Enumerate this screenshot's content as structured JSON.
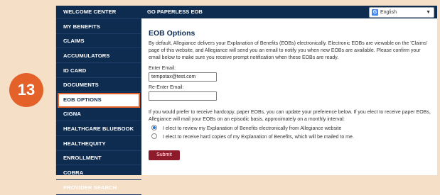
{
  "step_badge": "13",
  "sidebar": {
    "items": [
      {
        "label": "WELCOME CENTER"
      },
      {
        "label": "MY BENEFITS"
      },
      {
        "label": "CLAIMS"
      },
      {
        "label": "ACCUMULATORS"
      },
      {
        "label": "ID CARD"
      },
      {
        "label": "DOCUMENTS"
      },
      {
        "label": "EOB OPTIONS"
      },
      {
        "label": "CIGNA"
      },
      {
        "label": "HEALTHCARE BLUEBOOK"
      },
      {
        "label": "HEALTHEQUITY"
      },
      {
        "label": "ENROLLMENT"
      },
      {
        "label": "COBRA"
      },
      {
        "label": "PROVIDER SEARCH"
      }
    ],
    "active": "EOB OPTIONS"
  },
  "header": {
    "title": "GO PAPERLESS EOB",
    "language": "English"
  },
  "main": {
    "title": "EOB Options",
    "intro": "By default, Allegiance delivers your Explanation of Benefits (EOBs) electronically. Electronic EOBs are viewable on the 'Claims' page of this website, and Allegiance will send you an email to notify you when new EOBs are available. Please confirm your email below to make sure you receive prompt notification when these EOBs are ready.",
    "email_label": "Enter Email:",
    "email_value": "tempotax@test.com",
    "reenter_label": "Re-Enter Email:",
    "reenter_value": "",
    "pref_text": "If you would prefer to receive hardcopy, paper EOBs, you can update your preference below. If you elect to receive paper EOBs, Allegiance will mail your EOBs on an episodic basis, approximately on a monthly interval:",
    "options": [
      {
        "label": "I elect to review my Explanation of Benefits electronically from Allegiance website",
        "selected": true
      },
      {
        "label": "I elect to receive hard copies of my Explanation of Benefits, which will be mailed to me.",
        "selected": false
      }
    ],
    "submit_label": "Submit"
  },
  "colors": {
    "navy": "#0e2b50",
    "accent_orange": "#e4612a",
    "submit_red": "#8e1b2b",
    "background_peach": "#f6dfc7"
  }
}
